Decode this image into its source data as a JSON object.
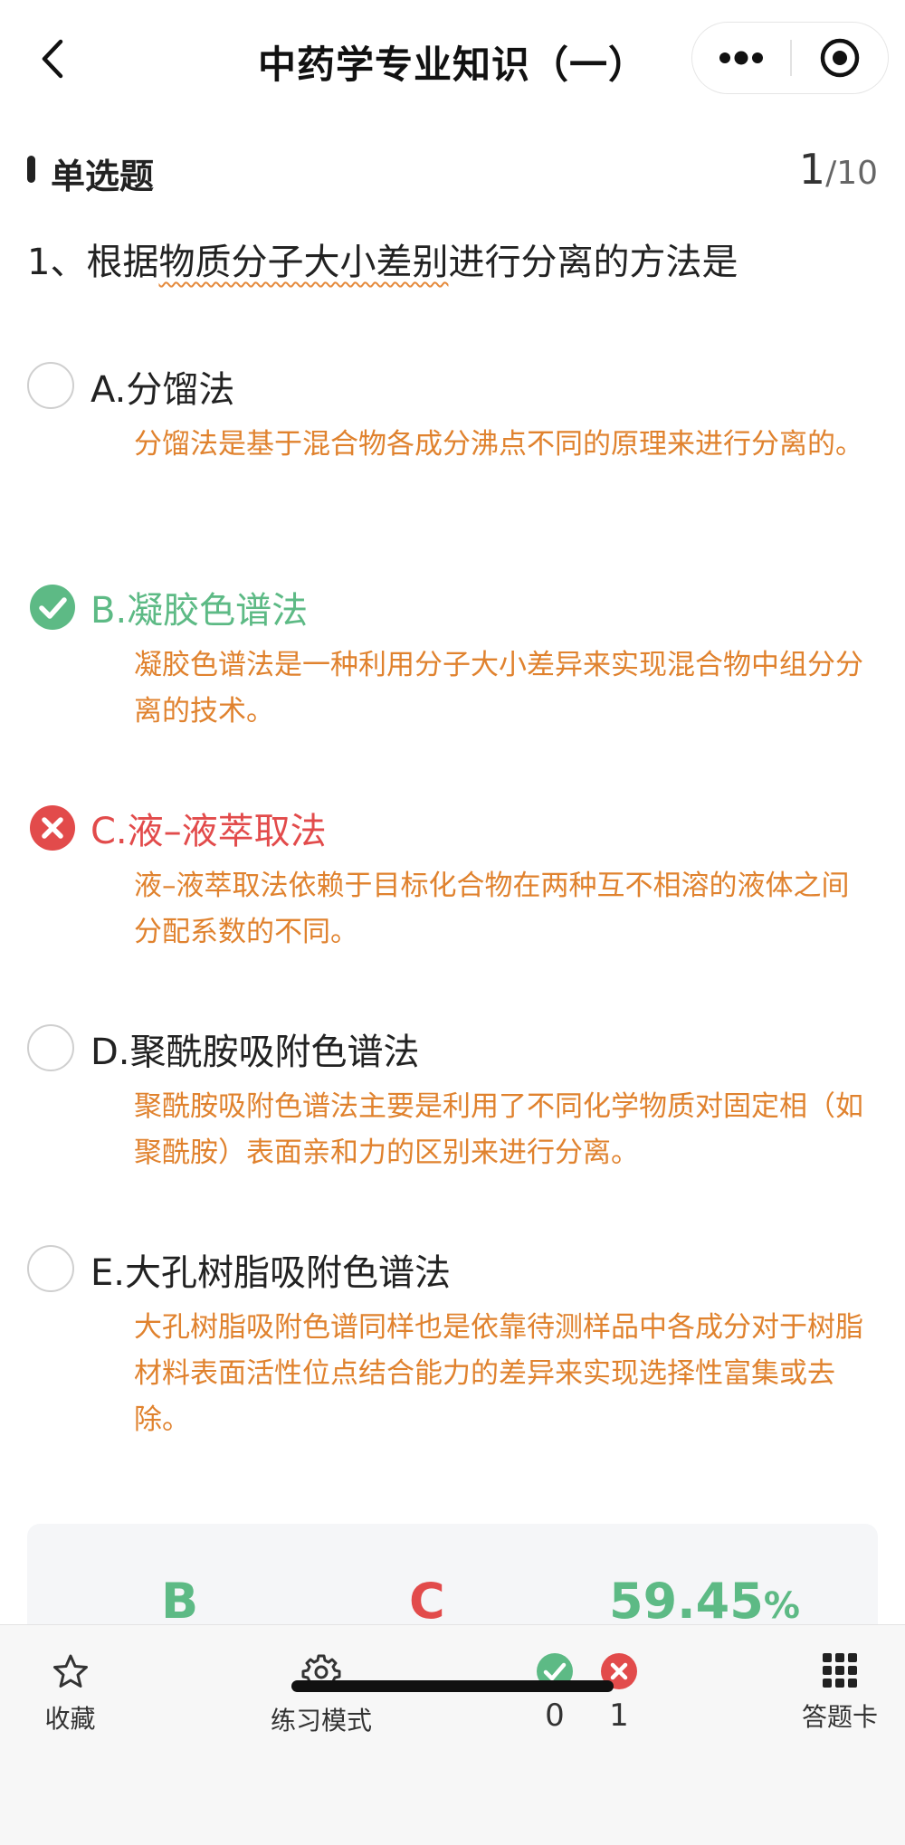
{
  "header": {
    "title": "中药学专业知识（一）"
  },
  "section": {
    "label": "单选题",
    "current": "1",
    "total": "/10"
  },
  "question": {
    "prefix": "1、根据",
    "highlight": "物质分子大小差别",
    "suffix": "进行分离的方法是"
  },
  "options": [
    {
      "letter": "A.",
      "text": "分馏法",
      "state": "none",
      "explanation": "分馏法是基于混合物各成分沸点不同的原理来进行分离的。"
    },
    {
      "letter": "B.",
      "text": "凝胶色谱法",
      "state": "correct",
      "explanation": "凝胶色谱法是一种利用分子大小差异来实现混合物中组分分离的技术。"
    },
    {
      "letter": "C.",
      "text": "液–液萃取法",
      "state": "wrong",
      "explanation": "液–液萃取法依赖于目标化合物在两种互不相溶的液体之间分配系数的不同。"
    },
    {
      "letter": "D.",
      "text": "聚酰胺吸附色谱法",
      "state": "none",
      "explanation": "聚酰胺吸附色谱法主要是利用了不同化学物质对固定相（如聚酰胺）表面亲和力的区别来进行分离。"
    },
    {
      "letter": "E.",
      "text": "大孔树脂吸附色谱法",
      "state": "none",
      "explanation": "大孔树脂吸附色谱同样也是依靠待测样品中各成分对于树脂材料表面活性位点结合能力的差异来实现选择性富集或去除。"
    }
  ],
  "result": {
    "correct_answer": "B",
    "your_answer": "C",
    "accuracy": "59.45",
    "accuracy_unit": "%"
  },
  "toolbar": {
    "favorite_label": "收藏",
    "mode_label": "练习模式",
    "correct_count": "0",
    "wrong_count": "1",
    "answer_card_label": "答题卡"
  },
  "colors": {
    "correct": "#5dba85",
    "wrong": "#e24b4b",
    "explanation": "#e0822e"
  }
}
